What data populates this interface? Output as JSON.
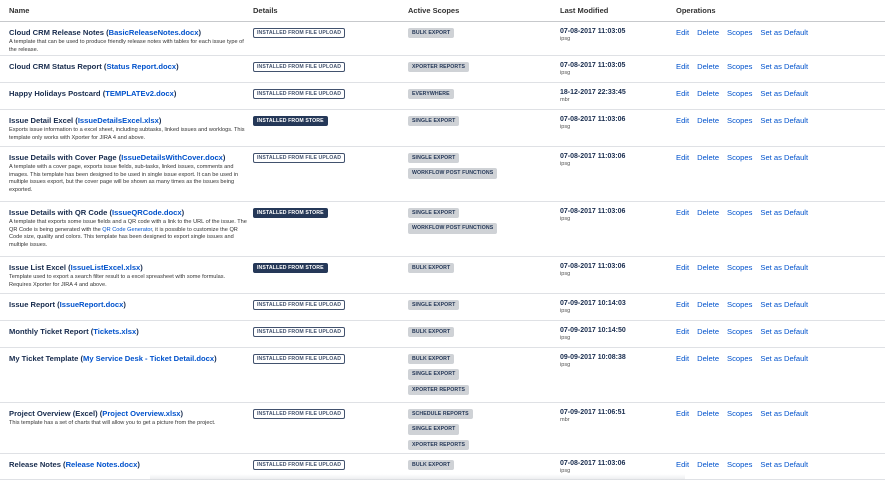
{
  "headers": {
    "name": "Name",
    "details": "Details",
    "scopes": "Active Scopes",
    "modified": "Last Modified",
    "operations": "Operations"
  },
  "ops": {
    "edit": "Edit",
    "delete": "Delete",
    "scopes": "Scopes",
    "default": "Set as Default"
  },
  "rows": [
    {
      "title": "Cloud CRM Release Notes",
      "file": "BasicReleaseNotes.docx",
      "desc": "A template that can be used to produce friendly release notes with tables for each issue type of the release.",
      "details": "INSTALLED FROM FILE UPLOAD",
      "scopes": [
        "BULK EXPORT"
      ],
      "date": "07-08-2017 11:03:05",
      "user": "ipsg"
    },
    {
      "title": "Cloud CRM Status Report",
      "file": "Status Report.docx",
      "desc": "",
      "details": "INSTALLED FROM FILE UPLOAD",
      "scopes": [
        "XPORTER REPORTS"
      ],
      "date": "07-08-2017 11:03:05",
      "user": "ipsg"
    },
    {
      "title": "Happy Holidays Postcard",
      "file": "TEMPLATEv2.docx",
      "desc": "",
      "details": "INSTALLED FROM FILE UPLOAD",
      "scopes": [
        "EVERYWHERE"
      ],
      "date": "18-12-2017 22:33:45",
      "user": "mbr"
    },
    {
      "title": "Issue Detail Excel",
      "file": "IssueDetailsExcel.xlsx",
      "desc": "Exports issue information to a excel sheet, including subtasks, linked issues and worklogs. This template only works with Xporter for JIRA 4 and above.",
      "details": "INSTALLED FROM STORE",
      "scopes": [
        "SINGLE EXPORT"
      ],
      "date": "07-08-2017 11:03:06",
      "user": "ipsg"
    },
    {
      "title": "Issue Details with Cover Page",
      "file": "IssueDetailsWithCover.docx",
      "desc": "A template with a cover page, exports issue fields, sub-tasks, linked issues, comments and images. This template has been designed to be used in single issue export. It can be used in multiple issues export, but the cover page will be shown as many times as the issues being exported.",
      "details": "INSTALLED FROM FILE UPLOAD",
      "scopes": [
        "SINGLE EXPORT",
        "WORKFLOW POST FUNCTIONS"
      ],
      "date": "07-08-2017 11:03:06",
      "user": "ipsg"
    },
    {
      "title": "Issue Details with QR Code",
      "file": "IssueQRCode.docx",
      "desc_a": "A template that exports some issue fields and a QR code with a link to the URL of the issue. The QR Code is being generated with the ",
      "desc_link": "QR Code Generator",
      "desc_b": ", it is possible to customize the QR Code size, quality and colors. This template has been designed to export single issues and multiple issues.",
      "details": "INSTALLED FROM STORE",
      "scopes": [
        "SINGLE EXPORT",
        "WORKFLOW POST FUNCTIONS"
      ],
      "date": "07-08-2017 11:03:06",
      "user": "ipsg"
    },
    {
      "title": "Issue List Excel",
      "file": "IssueListExcel.xlsx",
      "desc": "Template used to export a search filter result to a excel spreasheet with some formulas. Requires Xporter for JIRA 4 and above.",
      "details": "INSTALLED FROM STORE",
      "scopes": [
        "BULK EXPORT"
      ],
      "date": "07-08-2017 11:03:06",
      "user": "ipsg"
    },
    {
      "title": "Issue Report",
      "file": "IssueReport.docx",
      "desc": "",
      "details": "INSTALLED FROM FILE UPLOAD",
      "scopes": [
        "SINGLE EXPORT"
      ],
      "date": "07-09-2017 10:14:03",
      "user": "ipsg"
    },
    {
      "title": "Monthly Ticket Report",
      "file": "Tickets.xlsx",
      "desc": "",
      "details": "INSTALLED FROM FILE UPLOAD",
      "scopes": [
        "BULK EXPORT"
      ],
      "date": "07-09-2017 10:14:50",
      "user": "ipsg"
    },
    {
      "title": "My Ticket Template",
      "file": "My Service Desk - Ticket Detail.docx",
      "desc": "",
      "details": "INSTALLED FROM FILE UPLOAD",
      "scopes": [
        "BULK EXPORT",
        "SINGLE EXPORT",
        "XPORTER REPORTS"
      ],
      "date": "09-09-2017 10:08:38",
      "user": "ipsg"
    },
    {
      "title": "Project Overview (Excel)",
      "file": "Project Overview.xlsx",
      "desc": "This template has a set of charts that will allow you to get a picture from the project.",
      "details": "INSTALLED FROM FILE UPLOAD",
      "scopes": [
        "SCHEDULE REPORTS",
        "SINGLE EXPORT",
        "XPORTER REPORTS"
      ],
      "date": "07-09-2017 11:06:51",
      "user": "mbr"
    },
    {
      "title": "Release Notes",
      "file": "Release Notes.docx",
      "desc": "",
      "details": "INSTALLED FROM FILE UPLOAD",
      "scopes": [
        "BULK EXPORT"
      ],
      "date": "07-08-2017 11:03:06",
      "user": "ipsg"
    }
  ]
}
